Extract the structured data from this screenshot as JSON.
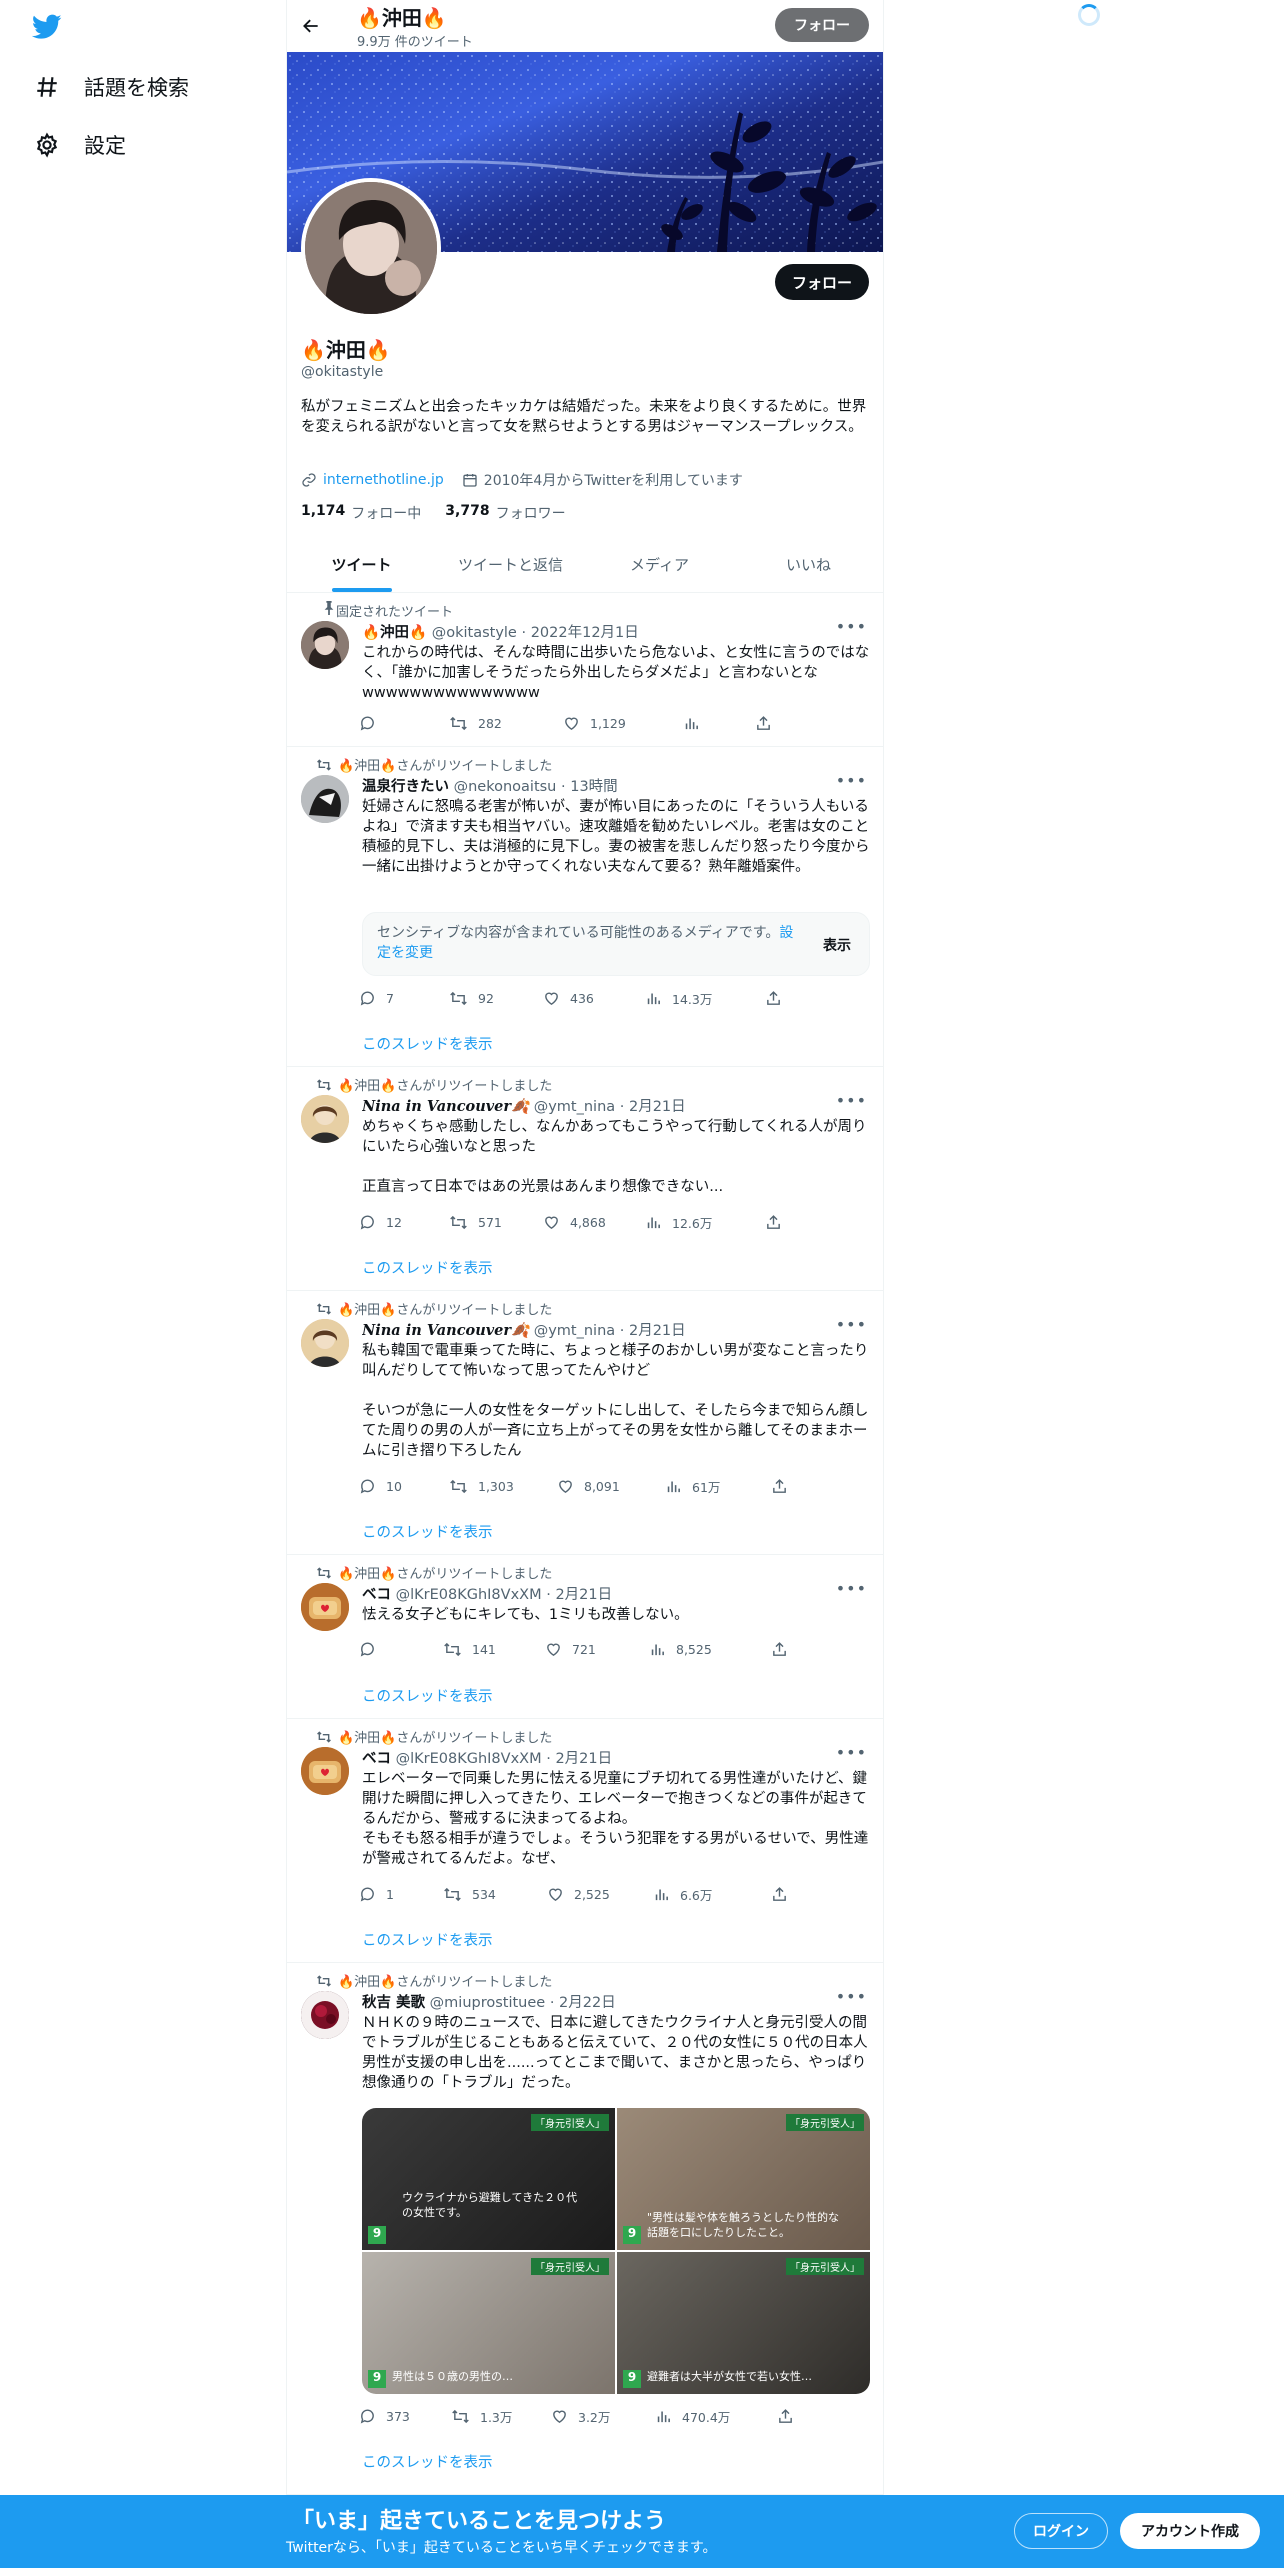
{
  "sidebar": {
    "items": [
      {
        "label": "話題を検索",
        "icon": "hashtag-icon"
      },
      {
        "label": "設定",
        "icon": "gear-icon"
      }
    ]
  },
  "header": {
    "name": "🔥沖田🔥",
    "tweet_count": "9.9万 件のツイート",
    "follow_label": "フォロー"
  },
  "profile": {
    "name": "🔥沖田🔥",
    "handle": "@okitastyle",
    "follow_label": "フォロー",
    "bio": "私がフェミニズムと出会ったキッカケは結婚だった。未来をより良くするために。世界を変えられる訳がないと言って女を黙らせようとする男はジャーマンスープレックス。",
    "link": "internethotline.jp",
    "joined": "2010年4月からTwitterを利用しています",
    "following_count": "1,174",
    "following_label": "フォロー中",
    "followers_count": "3,778",
    "followers_label": "フォロワー"
  },
  "tabs": [
    "ツイート",
    "ツイートと返信",
    "メディア",
    "いいね"
  ],
  "tweets": [
    {
      "context": "固定されたツイート",
      "name": "🔥沖田🔥",
      "handle": "@okitastyle",
      "time": "2022年12月1日",
      "text": "これからの時代は、そんな時間に出歩いたら危ないよ、と女性に言うのではなく、「誰かに加害しそうだったら外出したらダメだよ」と言わないとなwwwwwwwwwwwwwww",
      "replies": "",
      "retweets": "282",
      "likes": "1,129",
      "views": ""
    },
    {
      "context": "🔥沖田🔥さんがリツイートしました",
      "name": "温泉行きたい",
      "handle": "@nekonoaitsu",
      "time": "13時間",
      "text": "妊婦さんに怒鳴る老害が怖いが、妻が怖い目にあったのに「そういう人もいるよね」で済ます夫も相当ヤバい。速攻離婚を勧めたいレベル。老害は女のこと積極的見下し、夫は消極的に見下し。妻の被害を悲しんだり怒ったり今度から一緒に出掛けようとか守ってくれない夫なんて要る？熟年離婚案件。",
      "sensitive_text": "センシティブな内容が含まれている可能性のあるメディアです。",
      "sensitive_link": "設定を変更",
      "sensitive_button": "表示",
      "replies": "7",
      "retweets": "92",
      "likes": "436",
      "views": "14.3万",
      "thread": "このスレッドを表示"
    },
    {
      "context": "🔥沖田🔥さんがリツイートしました",
      "name": "Nina in Vancouver🍂",
      "handle": "@ymt_nina",
      "time": "2月21日",
      "text": "めちゃくちゃ感動したし、なんかあってもこうやって行動してくれる人が周りにいたら心強いなと思った\n\n正直言って日本ではあの光景はあんまり想像できない...",
      "replies": "12",
      "retweets": "571",
      "likes": "4,868",
      "views": "12.6万",
      "thread": "このスレッドを表示"
    },
    {
      "context": "🔥沖田🔥さんがリツイートしました",
      "name": "Nina in Vancouver🍂",
      "handle": "@ymt_nina",
      "time": "2月21日",
      "text": "私も韓国で電車乗ってた時に、ちょっと様子のおかしい男が変なこと言ったり叫んだりしてて怖いなって思ってたんやけど\n\nそいつが急に一人の女性をターゲットにし出して、そしたら今まで知らん顔してた周りの男の人が一斉に立ち上がってその男を女性から離してそのままホームに引き摺り下ろしたん",
      "replies": "10",
      "retweets": "1,303",
      "likes": "8,091",
      "views": "61万",
      "thread": "このスレッドを表示"
    },
    {
      "context": "🔥沖田🔥さんがリツイートしました",
      "name": "ベコ",
      "handle": "@lKrE08KGhI8VxXM",
      "time": "2月21日",
      "text": "怯える女子どもにキレても、1ミリも改善しない。",
      "replies": "",
      "retweets": "141",
      "likes": "721",
      "views": "8,525",
      "thread": "このスレッドを表示"
    },
    {
      "context": "🔥沖田🔥さんがリツイートしました",
      "name": "ベコ",
      "handle": "@lKrE08KGhI8VxXM",
      "time": "2月21日",
      "text": "エレベーターで同乗した男に怯える児童にブチ切れてる男性達がいたけど、鍵開けた瞬間に押し入ってきたり、エレベーターで抱きつくなどの事件が起きてるんだから、警戒するに決まってるよね。\nそもそも怒る相手が違うでしょ。そういう犯罪をする男がいるせいで、男性達が警戒されてるんだよ。なぜ、",
      "replies": "1",
      "retweets": "534",
      "likes": "2,525",
      "views": "6.6万",
      "thread": "このスレッドを表示"
    },
    {
      "context": "🔥沖田🔥さんがリツイートしました",
      "name": "秋吉 美歌",
      "handle": "@miuprostituee",
      "time": "2月22日",
      "text": "ＮＨＫの９時のニュースで、日本に避してきたウクライナ人と身元引受人の間でトラブルが生じることもあると伝えていて、２０代の女性に５０代の日本人男性が支援の申し出を......ってとこまで聞いて、まさかと思ったら、やっぱり想像通りの「トラブル」だった。",
      "media": [
        {
          "tag": "「身元引受人」",
          "caption": "ウクライナから避難してきた２０代の女性です。"
        },
        {
          "tag": "「身元引受人」",
          "caption": "\"男性は髪や体を触ろうとしたり性的な話題を口にしたりしたこと。"
        },
        {
          "tag": "「身元引受人」",
          "caption": "男性は５０歳の男性の…"
        },
        {
          "tag": "「身元引受人」",
          "caption": "避難者は大半が女性で若い女性…"
        }
      ],
      "replies": "373",
      "retweets": "1.3万",
      "likes": "3.2万",
      "views": "470.4万",
      "thread": "このスレッドを表示"
    }
  ],
  "banner": {
    "title": "「いま」起きていることを見つけよう",
    "subtitle": "Twitterなら、「いま」起きていることをいち早くチェックできます。",
    "login": "ログイン",
    "signup": "アカウント作成"
  },
  "colors": {
    "accent": "#1d9bf0",
    "text": "#0f1419",
    "muted": "#536471",
    "button_dark": "#0f1419"
  }
}
